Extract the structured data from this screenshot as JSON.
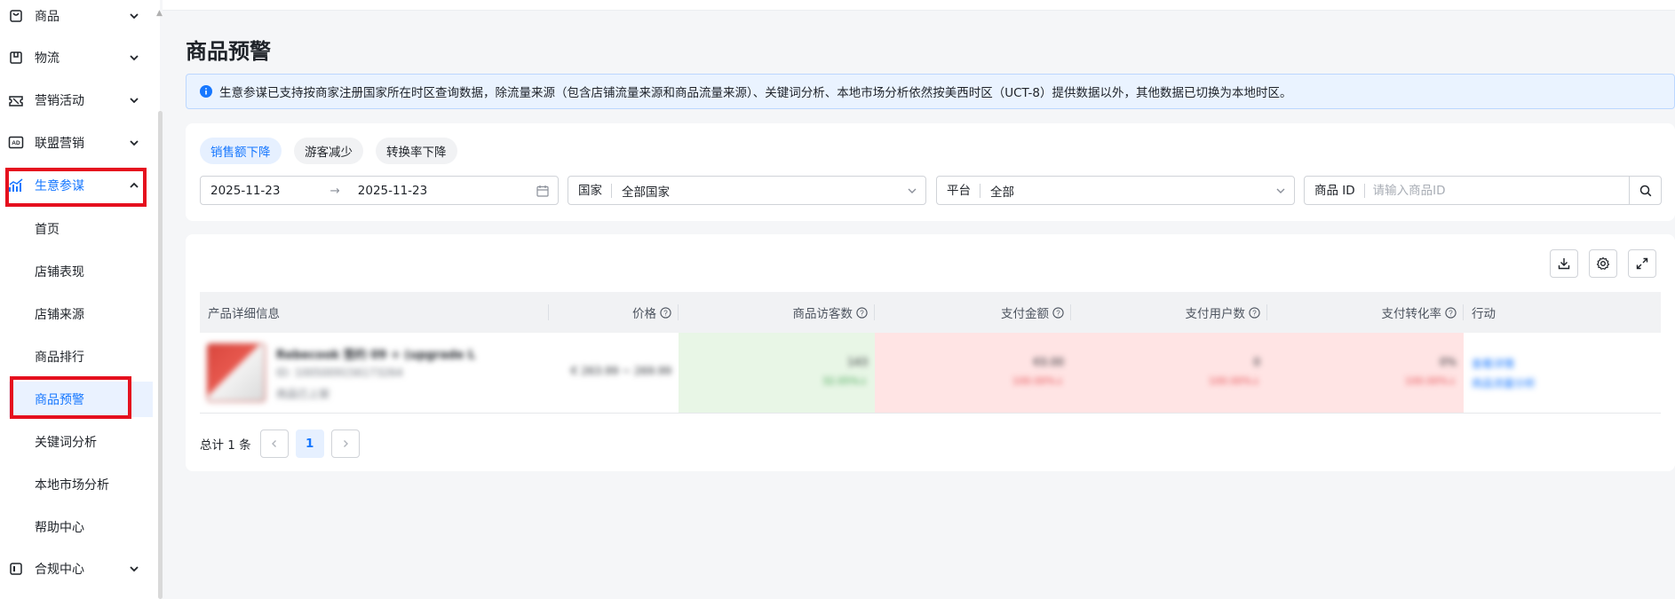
{
  "sidebar": {
    "items": [
      {
        "label": "商品",
        "icon": "shopping-bag-icon",
        "expanded": false
      },
      {
        "label": "物流",
        "icon": "package-icon",
        "expanded": false
      },
      {
        "label": "营销活动",
        "icon": "ticket-icon",
        "expanded": false
      },
      {
        "label": "联盟营销",
        "icon": "ad-icon",
        "expanded": false
      },
      {
        "label": "生意参谋",
        "icon": "chart-icon",
        "expanded": true,
        "active": true
      },
      {
        "label": "合规中心",
        "icon": "compliance-icon",
        "expanded": false
      }
    ],
    "sub_items": [
      {
        "label": "首页"
      },
      {
        "label": "店铺表现"
      },
      {
        "label": "店铺来源"
      },
      {
        "label": "商品排行"
      },
      {
        "label": "商品预警",
        "active": true
      },
      {
        "label": "关键词分析"
      },
      {
        "label": "本地市场分析"
      },
      {
        "label": "帮助中心"
      }
    ]
  },
  "page": {
    "title": "商品预警",
    "notice": "生意参谋已支持按商家注册国家所在时区查询数据，除流量来源（包含店铺流量来源和商品流量来源）、关键词分析、本地市场分析依然按美西时区（UCT-8）提供数据以外，其他数据已切换为本地时区。"
  },
  "filters": {
    "chips": [
      {
        "label": "销售额下降",
        "active": true
      },
      {
        "label": "游客减少",
        "active": false
      },
      {
        "label": "转换率下降",
        "active": false
      }
    ],
    "date_start": "2025-11-23",
    "date_end": "2025-11-23",
    "country_label": "国家",
    "country_value": "全部国家",
    "platform_label": "平台",
    "platform_value": "全部",
    "product_id_label": "商品 ID",
    "product_id_placeholder": "请输入商品ID"
  },
  "table": {
    "columns": [
      "产品详细信息",
      "价格",
      "商品访客数",
      "支付金额",
      "支付用户数",
      "支付转化率",
      "行动"
    ],
    "rows": [
      {
        "product_name": "Rebecook 签约 09 + (upgrade L",
        "product_id": "ID: 1005009156173264",
        "product_status": "商品已上架",
        "price": "€ 263.99 ~ 269.99",
        "visitors": "143",
        "visitors_change": "32.05%↓",
        "pay_amount": "€0.00",
        "pay_amount_change": "100.00%↓",
        "pay_users": "0",
        "pay_users_change": "100.00%↓",
        "conversion": "0%",
        "conversion_change": "100.00%↓",
        "action_1": "查看详情",
        "action_2": "商品流量分析"
      }
    ]
  },
  "pagination": {
    "total": "总计 1 条",
    "current_page": "1"
  },
  "colors": {
    "accent": "#1677ff",
    "highlight_red": "#e5101e",
    "cell_green": "#e8f6e6",
    "cell_red": "#ffe4e4"
  }
}
